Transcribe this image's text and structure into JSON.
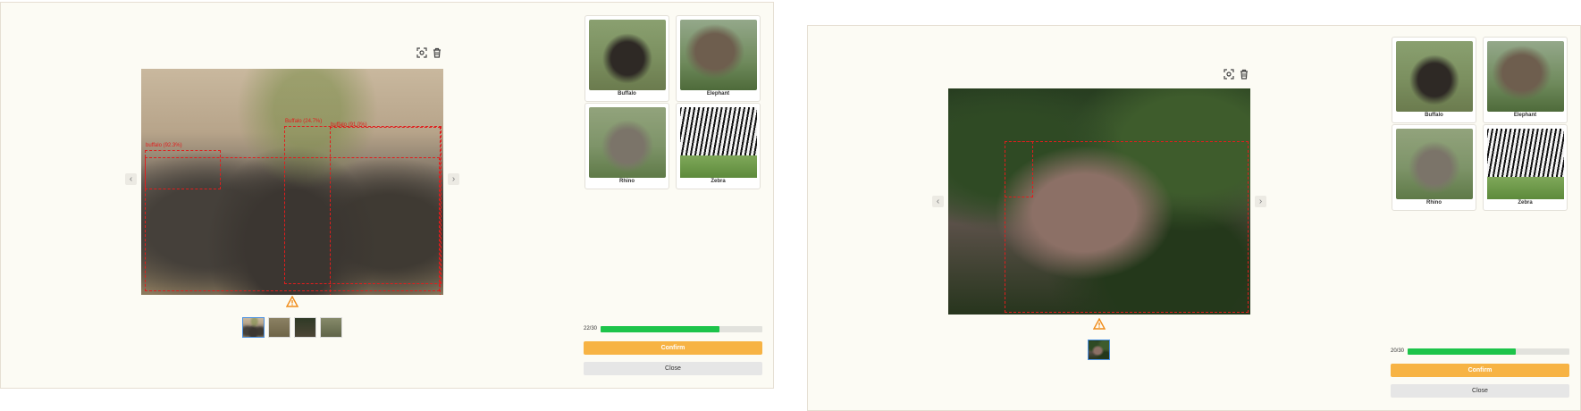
{
  "icons": {
    "screenshot": "scan-camera-icon",
    "delete": "trash-icon",
    "prev": "chevron-left-icon",
    "next": "chevron-right-icon",
    "warning": "warning-triangle-icon"
  },
  "colors": {
    "confirm": "#f7b344",
    "progress": "#1dc44a",
    "bbox": "#e11d1d",
    "panel": "#fcfbf4"
  },
  "species": [
    "Buffalo",
    "Elephant",
    "Rhino",
    "Zebra"
  ],
  "panels": [
    {
      "detections": [
        "buffalo (92.3%)",
        "Buffalo (24.7%)",
        "buffalo (91.0%)"
      ],
      "progress": {
        "text": "22/30",
        "value": 22,
        "total": 30
      },
      "confirm_label": "Confirm",
      "close_label": "Close",
      "thumbnail_count": 4,
      "active_thumbnail": 1
    },
    {
      "detections": [],
      "progress": {
        "text": "20/30",
        "value": 20,
        "total": 30
      },
      "confirm_label": "Confirm",
      "close_label": "Close",
      "thumbnail_count": 1,
      "active_thumbnail": 1
    }
  ]
}
